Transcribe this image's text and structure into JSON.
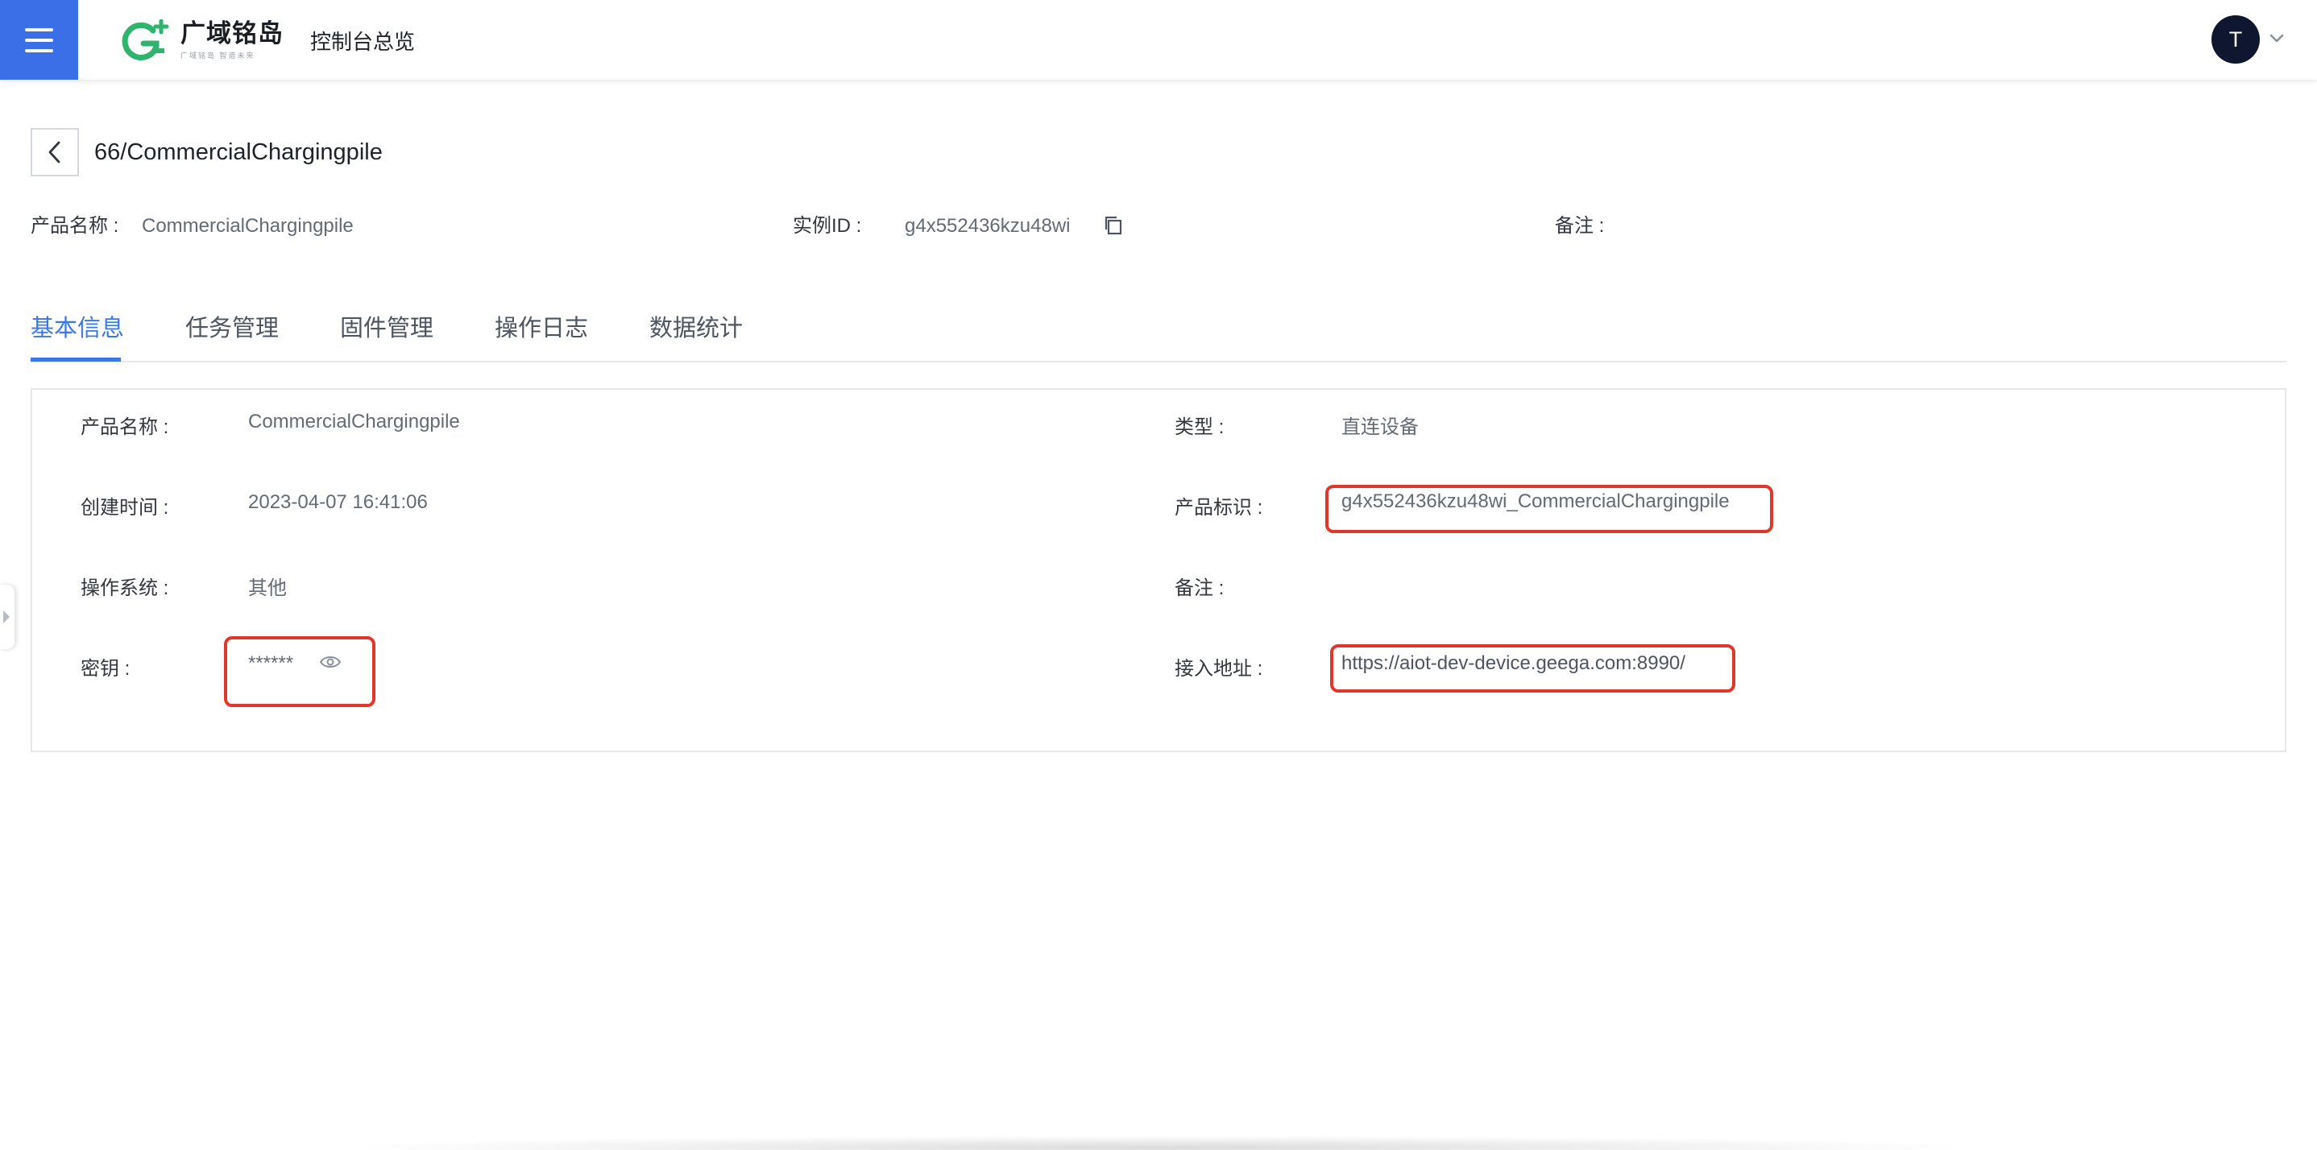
{
  "header": {
    "brand_name": "广域铭岛",
    "brand_tagline": "广域铭岛 智造未来",
    "console_link": "控制台总览",
    "user_initial": "T"
  },
  "page": {
    "title": "66/CommercialChargingpile"
  },
  "summary": {
    "product_name_label": "产品名称 :",
    "product_name_value": "CommercialChargingpile",
    "instance_id_label": "实例ID :",
    "instance_id_value": "g4x552436kzu48wi",
    "remark_label": "备注 :",
    "remark_value": ""
  },
  "tabs": [
    {
      "label": "基本信息",
      "active": true
    },
    {
      "label": "任务管理",
      "active": false
    },
    {
      "label": "固件管理",
      "active": false
    },
    {
      "label": "操作日志",
      "active": false
    },
    {
      "label": "数据统计",
      "active": false
    }
  ],
  "basic_info": {
    "product_name_label": "产品名称 :",
    "product_name_value": "CommercialChargingpile",
    "created_time_label": "创建时间 :",
    "created_time_value": "2023-04-07 16:41:06",
    "os_label": "操作系统 :",
    "os_value": "其他",
    "secret_label": "密钥 :",
    "secret_value": "******",
    "type_label": "类型 :",
    "type_value": "直连设备",
    "product_key_label": "产品标识 :",
    "product_key_value": "g4x552436kzu48wi_CommercialChargingpile",
    "remark_label": "备注 :",
    "remark_value": "",
    "endpoint_label": "接入地址 :",
    "endpoint_value": "https://aiot-dev-device.geega.com:8990/"
  },
  "colors": {
    "menu_bg": "#3b6fe8",
    "brand_green": "#2fb36d",
    "tab_active": "#3b78e7",
    "highlight_red": "#e0372b",
    "avatar_bg": "#0f1730"
  }
}
